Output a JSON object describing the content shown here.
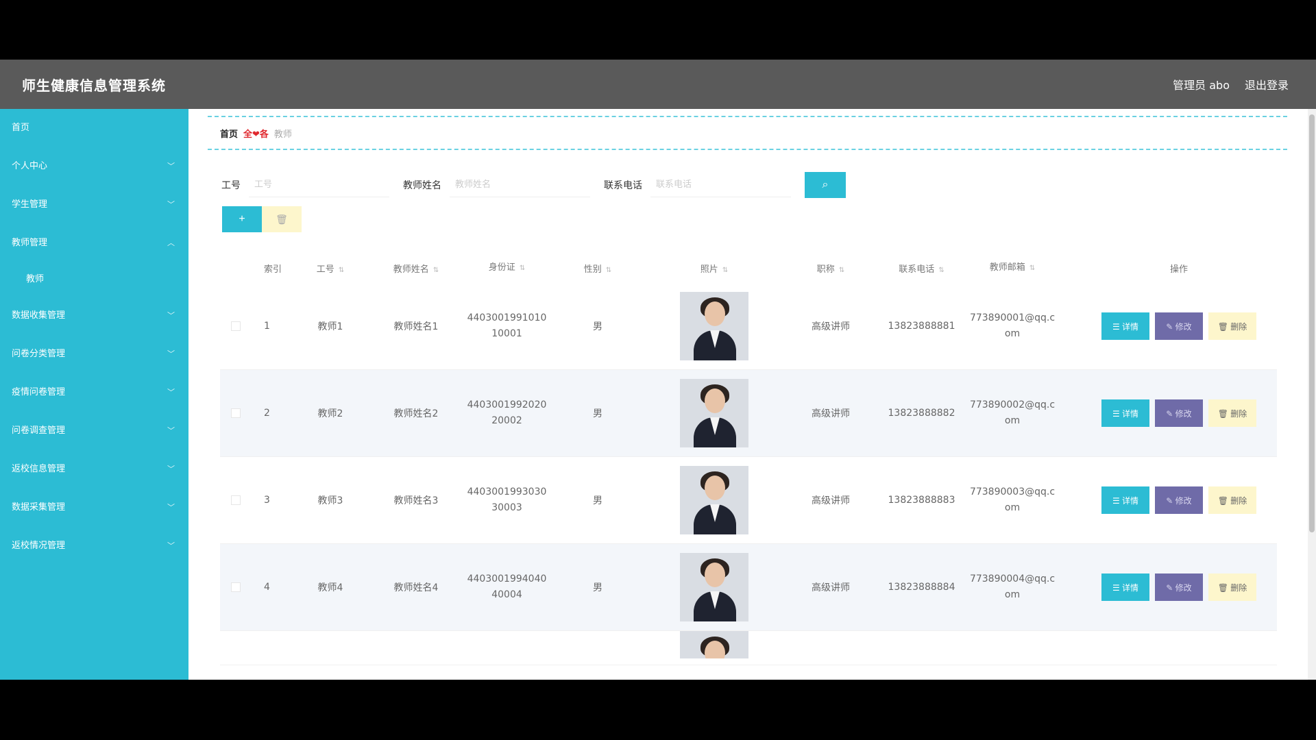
{
  "header": {
    "title": "师生健康信息管理系统",
    "user": "管理员 abo",
    "logout": "退出登录"
  },
  "sidebar": {
    "items": [
      {
        "label": "首页",
        "chevron": false
      },
      {
        "label": "个人中心",
        "chevron": true
      },
      {
        "label": "学生管理",
        "chevron": true
      },
      {
        "label": "教师管理",
        "chevron": true,
        "expanded": true
      },
      {
        "label": "教师",
        "sub": true
      },
      {
        "label": "数据收集管理",
        "chevron": true
      },
      {
        "label": "问卷分类管理",
        "chevron": true
      },
      {
        "label": "疫情问卷管理",
        "chevron": true
      },
      {
        "label": "问卷调查管理",
        "chevron": true
      },
      {
        "label": "返校信息管理",
        "chevron": true
      },
      {
        "label": "数据采集管理",
        "chevron": true
      },
      {
        "label": "返校情况管理",
        "chevron": true
      }
    ]
  },
  "breadcrumb": {
    "home": "首页",
    "separator": "全❤各",
    "current": "教师"
  },
  "search": {
    "fields": [
      {
        "label": "工号",
        "placeholder": "工号"
      },
      {
        "label": "教师姓名",
        "placeholder": "教师姓名"
      },
      {
        "label": "联系电话",
        "placeholder": "联系电话"
      }
    ],
    "button": "⌕"
  },
  "actions": {
    "add": "+",
    "delete": "🗑"
  },
  "table": {
    "headers": [
      "索引",
      "工号",
      "教师姓名",
      "身份证",
      "性别",
      "照片",
      "职称",
      "联系电话",
      "教师邮箱",
      "操作"
    ],
    "rows": [
      {
        "idx": "1",
        "no": "教师1",
        "name": "教师姓名1",
        "id": "440300199101010001",
        "sex": "男",
        "title": "高级讲师",
        "phone": "13823888881",
        "mail": "773890001@qq.com"
      },
      {
        "idx": "2",
        "no": "教师2",
        "name": "教师姓名2",
        "id": "440300199202020002",
        "sex": "男",
        "title": "高级讲师",
        "phone": "13823888882",
        "mail": "773890002@qq.com"
      },
      {
        "idx": "3",
        "no": "教师3",
        "name": "教师姓名3",
        "id": "440300199303030003",
        "sex": "男",
        "title": "高级讲师",
        "phone": "13823888883",
        "mail": "773890003@qq.com"
      },
      {
        "idx": "4",
        "no": "教师4",
        "name": "教师姓名4",
        "id": "440300199404040004",
        "sex": "男",
        "title": "高级讲师",
        "phone": "13823888884",
        "mail": "773890004@qq.com"
      }
    ],
    "ops": {
      "detail": "☰ 详情",
      "edit": "✎ 修改",
      "delete": "🗑 删除"
    }
  },
  "colors": {
    "accent": "#2cbcd4",
    "header": "#5a5a5a",
    "edit": "#6f6ba8",
    "warn": "#fdf6cc"
  }
}
